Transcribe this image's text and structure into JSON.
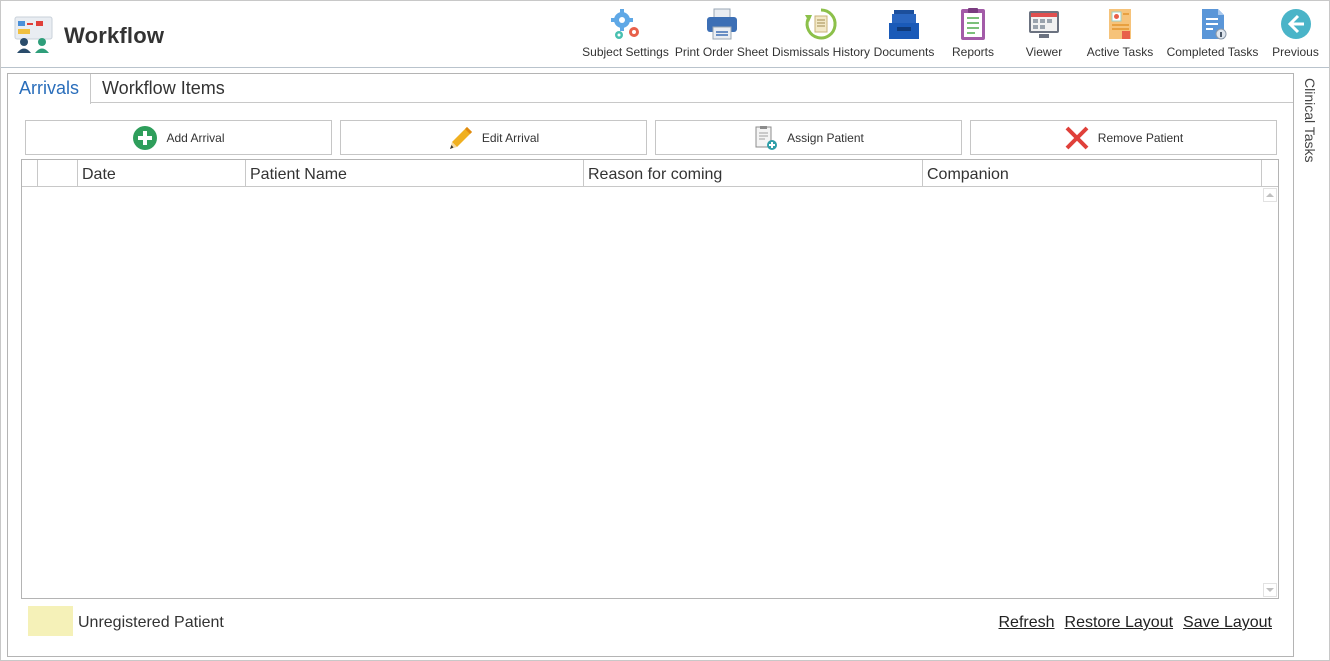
{
  "app": {
    "title": "Workflow",
    "logo_icon": "workflow-logo-icon"
  },
  "toolbar": {
    "items": [
      {
        "label": "Subject Settings",
        "icon": "gears-icon"
      },
      {
        "label": "Print Order Sheet",
        "icon": "printer-icon"
      },
      {
        "label": "Dismissals History",
        "icon": "history-icon"
      },
      {
        "label": "Documents",
        "icon": "documents-tray-icon"
      },
      {
        "label": "Reports",
        "icon": "clipboard-report-icon"
      },
      {
        "label": "Viewer",
        "icon": "viewer-monitor-icon"
      },
      {
        "label": "Active Tasks",
        "icon": "active-tasks-icon"
      },
      {
        "label": "Completed Tasks",
        "icon": "completed-tasks-icon"
      },
      {
        "label": "Previous",
        "icon": "back-arrow-icon"
      }
    ]
  },
  "tabs": [
    {
      "label": "Arrivals",
      "active": true
    },
    {
      "label": "Workflow Items",
      "active": false
    }
  ],
  "actions": [
    {
      "label": "Add Arrival",
      "icon": "plus-circle-icon"
    },
    {
      "label": "Edit Arrival",
      "icon": "pencil-icon"
    },
    {
      "label": "Assign Patient",
      "icon": "assign-document-icon"
    },
    {
      "label": "Remove Patient",
      "icon": "red-x-icon"
    }
  ],
  "grid": {
    "columns": [
      "",
      "",
      "Date",
      "Patient Name",
      "Reason for coming",
      "Companion"
    ],
    "rows": []
  },
  "legend": {
    "label": "Unregistered Patient",
    "swatch_color": "#f5f1b8"
  },
  "footer": {
    "refresh": "Refresh",
    "restore_layout": "Restore Layout",
    "save_layout": "Save Layout"
  },
  "side_panel": {
    "label": "Clinical Tasks"
  },
  "colors": {
    "accent": "#2a6ebb",
    "add_green": "#2e9e5b",
    "remove_red": "#e0403a"
  }
}
